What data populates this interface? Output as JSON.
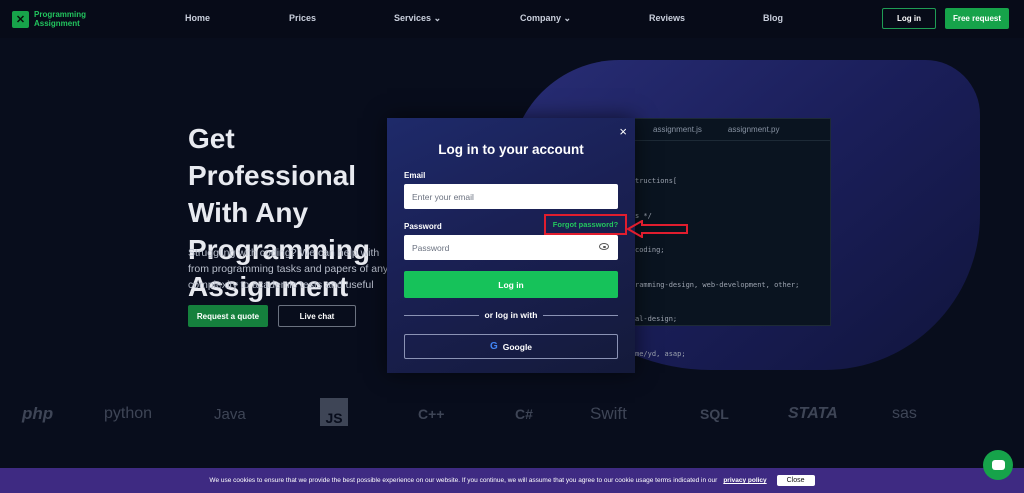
{
  "header": {
    "logo_text": "Programming Assignment",
    "nav": [
      "Home",
      "Prices",
      "Services",
      "Company",
      "Reviews",
      "Blog"
    ],
    "login_label": "Log in",
    "free_request_label": "Free request"
  },
  "hero": {
    "title": "Get Professional With Any Programming Assignment",
    "description": "Struggling with coding? We can help with from programming tasks and papers of any complexity to academic tests and useful",
    "quote_label": "Request a quote",
    "chat_label": "Live chat"
  },
  "code": {
    "tabs": [
      "assignment.js",
      "assignment.py"
    ],
    "lines": [
      "tructions[",
      "s */",
      "coding;",
      "ramming-design, web-development, other;",
      "al-design;",
      "me/yd, asap;"
    ]
  },
  "techs": [
    "php",
    "python",
    "Java",
    "JS",
    "C++",
    "C#",
    "Swift",
    "SQL",
    "STATA",
    "sas"
  ],
  "modal": {
    "title": "Log in to your account",
    "email_label": "Email",
    "email_placeholder": "Enter your email",
    "password_label": "Password",
    "password_placeholder": "Password",
    "forgot_label": "Forgot password?",
    "login_label": "Log in",
    "or_label": "or log in with",
    "google_label": "Google",
    "close_symbol": "×"
  },
  "cookie": {
    "text": "We use cookies to ensure that we provide the best possible experience on our website. If you continue, we will assume that you agree to our cookie usage terms indicated in our",
    "link": "privacy policy",
    "close_label": "Close"
  }
}
